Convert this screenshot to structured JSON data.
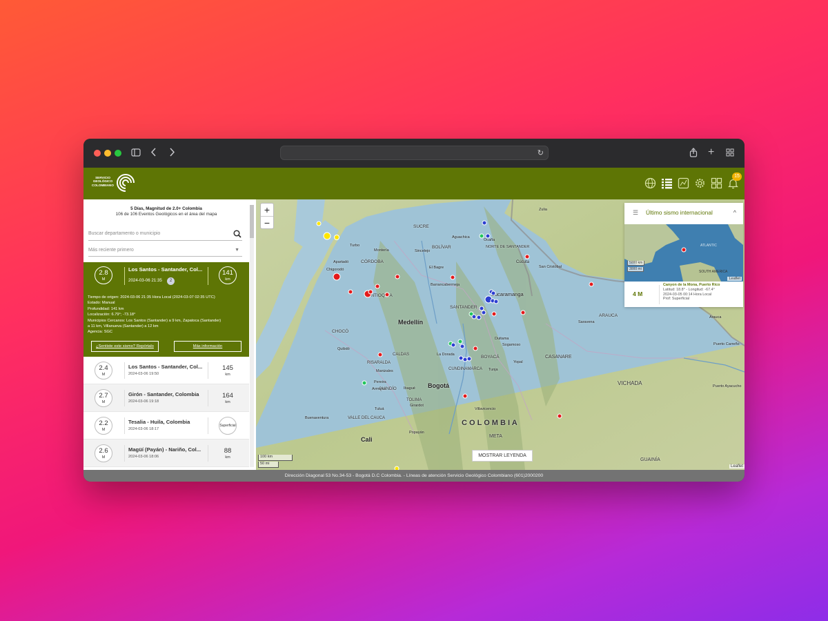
{
  "browser": {
    "url": "",
    "toolbar_icons": [
      "sidebar-icon",
      "back-icon",
      "forward-icon",
      "share-icon",
      "new-tab-icon",
      "tab-overview-icon"
    ]
  },
  "app": {
    "logo_text_line1": "SERVICIO",
    "logo_text_line2": "GEOLÓGICO",
    "logo_text_line3": "COLOMBIANO",
    "nav_icons": [
      "globe-icon",
      "list-icon",
      "map-layers-icon",
      "settings-icon",
      "grid-icon",
      "bell-icon"
    ],
    "notification_count": "15",
    "brand_color": "#5e7505"
  },
  "sidebar": {
    "summary_title": "5 Días, Magnitud de 2.0+ Colombia",
    "summary_count": "106 de 106 Eventos Geológicos en el área del mapa",
    "search_placeholder": "Buscar departamento o municipio",
    "sort_label": "Más reciente primero",
    "selected": {
      "magnitude": "2.8",
      "magnitude_unit": "M",
      "title": "Los Santos - Santander, Col...",
      "date": "2024-03-06 21:35",
      "count": "2",
      "depth": "141",
      "depth_unit": "km",
      "details": [
        "Tiempo de origen: 2024-03-06 21:35 Hora Local (2024-03-07 02:35 UTC)",
        "Estado: Manual",
        "Profundidad: 141 km",
        "Localización: 6.79°; -73.18°",
        "Municipios Cercanos: Los Santos (Santander) a 9 km, Zapatoca (Santander)",
        "a 11 km, Villanueva (Santander) a 12 km",
        "Agencia: SGC"
      ],
      "report_button": "¿Sentiste este sismo? Repórtalo",
      "more_info_button": "Más información"
    },
    "events": [
      {
        "magnitude": "2.4",
        "unit": "M",
        "title": "Los Santos - Santander, Col...",
        "date": "2024-03-06 19:50",
        "depth": "145",
        "depth_unit": "km"
      },
      {
        "magnitude": "2.7",
        "unit": "M",
        "title": "Girón - Santander, Colombia",
        "date": "2024-03-06 19:18",
        "depth": "164",
        "depth_unit": "km"
      },
      {
        "magnitude": "2.2",
        "unit": "M",
        "title": "Tesalia - Huila, Colombia",
        "date": "2024-03-06 18:17",
        "depth": "Superficial",
        "depth_unit": ""
      },
      {
        "magnitude": "2.6",
        "unit": "M",
        "title": "Magüí (Payán) - Nariño, Col...",
        "date": "2024-03-06 18:06",
        "depth": "88",
        "depth_unit": "km"
      }
    ]
  },
  "map": {
    "zoom_in": "+",
    "zoom_out": "−",
    "labels": {
      "colombia": "C O L O M B I A",
      "medellin": "Medellín",
      "bogota": "Bogotá",
      "cali": "Cali",
      "bucaramanga": "Bucaramanga",
      "cucuta": "Cúcuta",
      "vichada": "VICHADA",
      "casanare": "CASANARE",
      "arauca": "ARAUCA",
      "guainia": "GUAINÍA",
      "meta": "META",
      "santander": "SANTANDER",
      "antioquia": "ANTIOQUIA",
      "choco": "CHOCÓ",
      "cordoba": "CÓRDOBA",
      "sucre": "SUCRE",
      "bolivar": "BOLÍVAR",
      "norte_santander": "NORTE DE SANTANDER",
      "boyaca": "BOYACÁ",
      "cundinamarca": "CUNDINAMARCA",
      "caldas": "CALDAS",
      "risaralda": "RISARALDA",
      "quindio": "QUINDÍO",
      "valle": "VALLE DEL CAUCA",
      "tolima": "TOLIMA",
      "apartado": "Apartadó",
      "monteria": "Montería",
      "barrancabermeja": "Barrancabermeja",
      "aguachica": "Aguachica",
      "ocana": "Ocaña",
      "sincelejo": "Sincelejo",
      "elbagre": "El Bagre",
      "quibdo": "Quibdó",
      "pereira": "Pereira",
      "manizales": "Manizales",
      "armenia": "Armenia",
      "ibague": "Ibagué",
      "tulua": "Tuluá",
      "buenaventura": "Buenaventura",
      "tunja": "Tunja",
      "yopal": "Yopal",
      "villavicencio": "Villavicencio",
      "girardot": "Girardot",
      "duitama": "Duitama",
      "sogamoso": "Sogamoso",
      "ladorada": "La Dorada",
      "saravena": "Saravena",
      "arauca_city": "Arauca",
      "puerto_carreno": "Puerto Carreño",
      "san_cristobal": "San Cristóbal",
      "puerto_ayacucho": "Puerto Ayacucho",
      "pasto": "Popayán",
      "chigorodo": "Chigorodó",
      "turbo": "Turbo",
      "zulia": "Zulia"
    },
    "scale_km": "100 km",
    "scale_mi": "50 mi",
    "legend_button": "MOSTRAR LEYENDA",
    "attribution": "Leaflet",
    "quake_colors": {
      "shallow": "#e31a1c",
      "intermediate": "#2c3fd1",
      "deep": "#22c55e",
      "recent": "#ffe600"
    }
  },
  "intl_panel": {
    "title": "Último sismo internacional",
    "scale_km": "5000 km",
    "scale_mi": "3000 mi",
    "attribution": "Leaflet",
    "inset_label_atlantic": "ATLANTIC",
    "inset_label_south_america": "SOUTH AMERICA",
    "magnitude": "4 M",
    "place": "Canyon de la Mona, Puerto Rico",
    "coords": "Latitud: 18.8° - Longitud: -67.4°",
    "time": "2024-03-05 00:14 Hora Local",
    "depth": "Prof: Superficial"
  },
  "footer": {
    "text": "Dirección Diagonal 53 No.34-53 - Bogotá D.C Colombia. - Líneas de atención Servicio Geológico Colombiano (601)2000200"
  }
}
